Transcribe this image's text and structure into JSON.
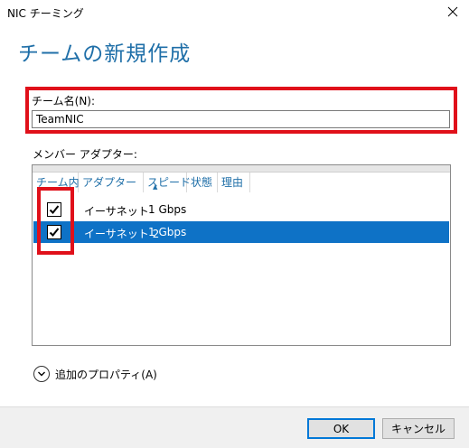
{
  "window": {
    "title": "NIC チーミング",
    "close_label": "×"
  },
  "heading": "チームの新規作成",
  "team_name": {
    "label": "チーム名(N):",
    "value": "TeamNIC"
  },
  "members": {
    "label": "メンバー アダプター:",
    "columns": [
      "チーム内",
      "アダプター",
      "スピード",
      "状態",
      "理由"
    ],
    "rows": [
      {
        "checked": true,
        "adapter": "イーサネット",
        "speed": "1 Gbps",
        "status": "",
        "reason": "",
        "selected": false
      },
      {
        "checked": true,
        "adapter": "イーサネット 2",
        "speed": "1 Gbps",
        "status": "",
        "reason": "",
        "selected": true
      }
    ]
  },
  "additional_properties": {
    "label": "追加のプロパティ(A)"
  },
  "buttons": {
    "ok": "OK",
    "cancel": "キャンセル"
  },
  "colors": {
    "accent": "#1f6fa8",
    "selection": "#0e72c6",
    "highlight_box": "#e0101a"
  }
}
